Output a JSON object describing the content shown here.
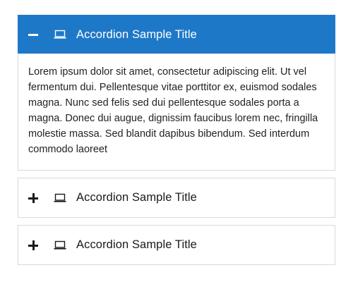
{
  "accordion": {
    "items": [
      {
        "title": "Accordion Sample Title",
        "state": "expanded",
        "toggle_icon": "minus-icon",
        "icon": "laptop-icon",
        "body": "Lorem ipsum dolor sit amet, consectetur adipiscing elit. Ut vel fermentum dui. Pellentesque vitae porttitor ex, euismod sodales magna. Nunc sed felis sed dui pellentesque sodales porta a magna. Donec dui augue, dignissim faucibus lorem nec, fringilla molestie massa. Sed blandit dapibus bibendum. Sed interdum commodo laoreet"
      },
      {
        "title": "Accordion Sample Title",
        "state": "collapsed",
        "toggle_icon": "plus-icon",
        "icon": "laptop-icon"
      },
      {
        "title": "Accordion Sample Title",
        "state": "collapsed",
        "toggle_icon": "plus-icon",
        "icon": "laptop-icon"
      }
    ]
  },
  "colors": {
    "active_header": "#1e78c8",
    "border": "#d9d9d9",
    "text": "#1a1a1a"
  }
}
